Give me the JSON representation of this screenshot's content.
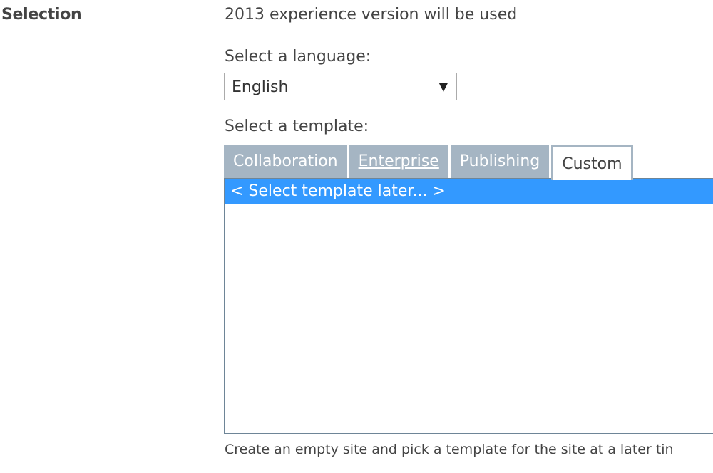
{
  "section": {
    "label": "Selection"
  },
  "experience": {
    "text": "2013 experience version will be used"
  },
  "language": {
    "label": "Select a language:",
    "selected": "English",
    "arrow": "▼"
  },
  "template": {
    "label": "Select a template:",
    "tabs": [
      {
        "label": "Collaboration"
      },
      {
        "label": "Enterprise"
      },
      {
        "label": "Publishing"
      },
      {
        "label": "Custom"
      }
    ],
    "active_tab": "Custom",
    "items": [
      {
        "label": "< Select template later... >",
        "selected": true
      }
    ],
    "description": "Create an empty site and pick a template for the site at a later tin"
  },
  "colors": {
    "tab_background": "#a5b5c3",
    "selection_highlight": "#3399ff",
    "listbox_border": "#6e8597"
  }
}
